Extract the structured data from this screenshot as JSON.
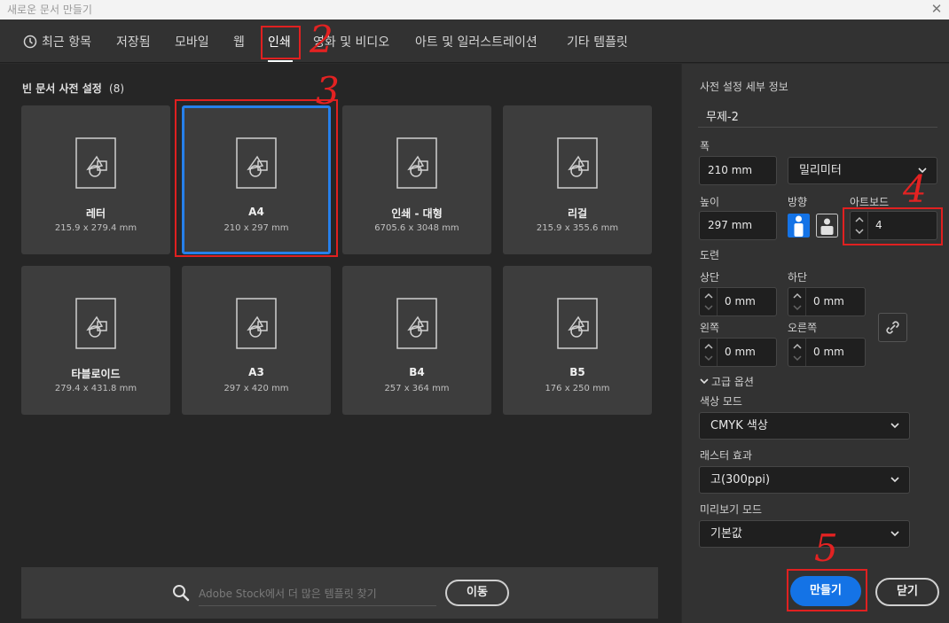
{
  "window": {
    "title": "새로운 문서 만들기",
    "close_glyph": "✕"
  },
  "tabs": [
    {
      "label": "최근 항목",
      "icon": "clock-icon"
    },
    {
      "label": "저장됨"
    },
    {
      "label": "모바일"
    },
    {
      "label": "웹"
    },
    {
      "label": "인쇄",
      "active": true
    },
    {
      "label": "영화 및 비디오"
    },
    {
      "label": "아트 및 일러스트레이션"
    },
    {
      "label": "기타 템플릿"
    }
  ],
  "presets": {
    "title": "빈 문서 사전 설정",
    "count": "(8)",
    "items": [
      {
        "name": "레터",
        "size": "215.9 x 279.4 mm"
      },
      {
        "name": "A4",
        "size": "210 x 297 mm",
        "selected": true
      },
      {
        "name": "인쇄 - 대형",
        "size": "6705.6 x 3048 mm"
      },
      {
        "name": "리걸",
        "size": "215.9 x 355.6 mm"
      },
      {
        "name": "타블로이드",
        "size": "279.4 x 431.8 mm"
      },
      {
        "name": "A3",
        "size": "297 x 420 mm"
      },
      {
        "name": "B4",
        "size": "257 x 364 mm"
      },
      {
        "name": "B5",
        "size": "176 x 250 mm"
      }
    ]
  },
  "stock": {
    "placeholder": "Adobe Stock에서 더 많은 템플릿 찾기",
    "go_label": "이동"
  },
  "details": {
    "header": "사전 설정 세부 정보",
    "doc_name": "무제-2",
    "width_label": "폭",
    "width_value": "210 mm",
    "unit_value": "밀리미터",
    "height_label": "높이",
    "height_value": "297 mm",
    "orientation_label": "방향",
    "artboards_label": "아트보드",
    "artboards_value": "4",
    "bleed_label": "도련",
    "top_label": "상단",
    "top_value": "0 mm",
    "bottom_label": "하단",
    "bottom_value": "0 mm",
    "left_label": "왼쪽",
    "left_value": "0 mm",
    "right_label": "오른쪽",
    "right_value": "0 mm",
    "advanced_label": "고급 옵션",
    "color_mode_label": "색상 모드",
    "color_mode_value": "CMYK 색상",
    "raster_label": "래스터 효과",
    "raster_value": "고(300ppi)",
    "preview_label": "미리보기 모드",
    "preview_value": "기본값"
  },
  "actions": {
    "create_label": "만들기",
    "close_label": "닫기"
  },
  "annotations": [
    "2",
    "3",
    "4",
    "5"
  ],
  "colors": {
    "accent": "#1473e6",
    "selection": "#2680eb",
    "annotation": "#e02020"
  }
}
